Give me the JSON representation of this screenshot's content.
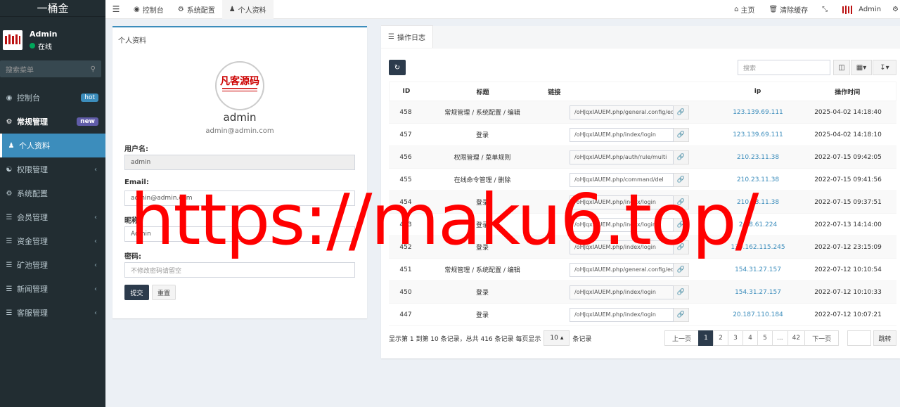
{
  "brand": "一桶金",
  "user": {
    "name": "Admin",
    "status": "在线"
  },
  "sidebar": {
    "search_placeholder": "搜索菜单",
    "items": [
      {
        "label": "控制台",
        "icon": "dashboard-icon",
        "badge": "hot",
        "badge_color": "#3c8dbc"
      },
      {
        "label": "常规管理",
        "icon": "cogs-icon",
        "badge": "new",
        "badge_color": "#605ca8"
      },
      {
        "label": "个人资料",
        "icon": "user-icon",
        "active": true
      },
      {
        "label": "权限管理",
        "icon": "group-icon",
        "chevron": true
      },
      {
        "label": "系统配置",
        "icon": "cog-icon"
      },
      {
        "label": "会员管理",
        "icon": "list-icon",
        "chevron": true
      },
      {
        "label": "资金管理",
        "icon": "list-icon",
        "chevron": true
      },
      {
        "label": "矿池管理",
        "icon": "list-icon",
        "chevron": true
      },
      {
        "label": "新闻管理",
        "icon": "list-icon",
        "chevron": true
      },
      {
        "label": "客服管理",
        "icon": "list-icon",
        "chevron": true
      }
    ]
  },
  "header": {
    "tabs": [
      {
        "label": "控制台",
        "icon": "dashboard-icon"
      },
      {
        "label": "系统配置",
        "icon": "cog-icon"
      },
      {
        "label": "个人资料",
        "icon": "user-icon",
        "active": true
      }
    ],
    "right": {
      "home": "主页",
      "clear_cache": "清除缓存",
      "admin": "Admin"
    }
  },
  "profile": {
    "card_title": "个人资料",
    "name": "admin",
    "email": "admin@admin.com",
    "username_label": "用户名:",
    "username_value": "admin",
    "email_label": "Email:",
    "email_value": "admin@admin.com",
    "nickname_label": "昵称:",
    "nickname_value": "Admin",
    "password_label": "密码:",
    "password_placeholder": "不修改密码请留空",
    "submit_label": "提交",
    "reset_label": "重置"
  },
  "log": {
    "tab_label": "操作日志",
    "search_placeholder": "搜索",
    "columns": {
      "id": "ID",
      "title": "标题",
      "link": "链接",
      "ip": "ip",
      "time": "操作时间"
    },
    "rows": [
      {
        "id": "458",
        "title": "常规管理 / 系统配置 / 编辑",
        "link": "/oHJqxIAUEM.php/general.config/edit",
        "ip": "123.139.69.111",
        "time": "2025-04-02 14:18:40"
      },
      {
        "id": "457",
        "title": "登录",
        "link": "/oHJqxIAUEM.php/index/login",
        "ip": "123.139.69.111",
        "time": "2025-04-02 14:18:10"
      },
      {
        "id": "456",
        "title": "权限管理 / 菜单规则",
        "link": "/oHJqxIAUEM.php/auth/rule/multi",
        "ip": "210.23.11.38",
        "time": "2022-07-15 09:42:05"
      },
      {
        "id": "455",
        "title": "在线命令管理 / 删除",
        "link": "/oHJqxIAUEM.php/command/del",
        "ip": "210.23.11.38",
        "time": "2022-07-15 09:41:56"
      },
      {
        "id": "454",
        "title": "登录",
        "link": "/oHJqxIAUEM.php/index/login",
        "ip": "210.23.11.38",
        "time": "2022-07-15 09:37:51"
      },
      {
        "id": "453",
        "title": "登录",
        "link": "/oHJqxIAUEM.php/index/login",
        "ip": "2.48.61.224",
        "time": "2022-07-13 14:14:00"
      },
      {
        "id": "452",
        "title": "登录",
        "link": "/oHJqxIAUEM.php/index/login",
        "ip": "139.162.115.245",
        "time": "2022-07-12 23:15:09"
      },
      {
        "id": "451",
        "title": "常规管理 / 系统配置 / 编辑",
        "link": "/oHJqxIAUEM.php/general.config/edit",
        "ip": "154.31.27.157",
        "time": "2022-07-12 10:10:54"
      },
      {
        "id": "450",
        "title": "登录",
        "link": "/oHJqxIAUEM.php/index/login",
        "ip": "154.31.27.157",
        "time": "2022-07-12 10:10:33"
      },
      {
        "id": "447",
        "title": "登录",
        "link": "/oHJqxIAUEM.php/index/login",
        "ip": "20.187.110.184",
        "time": "2022-07-12 10:07:21"
      }
    ],
    "pager_info_prefix": "显示第 1 到第 10 条记录，总共 416 条记录 每页显示",
    "page_size": "10",
    "pager_info_suffix": "条记录",
    "pages": [
      "上一页",
      "1",
      "2",
      "3",
      "4",
      "5",
      "...",
      "42",
      "下一页"
    ],
    "jump_label": "跳转"
  },
  "avatar_text": "凡客源码",
  "watermark": "https://maku6.top/"
}
